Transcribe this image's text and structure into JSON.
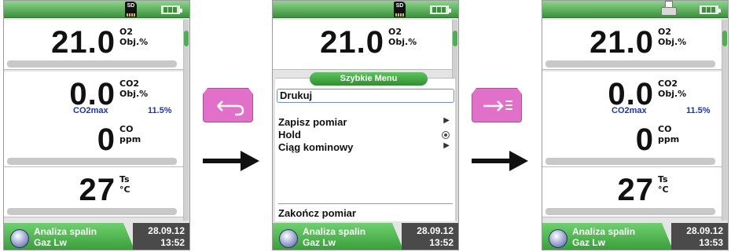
{
  "screen_1": {
    "top": {
      "sd_label": "SD"
    },
    "panels": [
      {
        "value": "21.0",
        "gas": "O2",
        "unit": "Obj.%"
      },
      {
        "value": "0.0",
        "gas": "CO2",
        "unit": "Obj.%",
        "sub_label": "CO2max",
        "sub_value": "11.5%"
      },
      {
        "value": "0",
        "gas": "CO",
        "unit": "ppm"
      },
      {
        "value": "27",
        "gas": "Ts",
        "unit": "°C"
      }
    ],
    "status": {
      "mode": "Analiza spalin",
      "fuel": "Gaz Lw",
      "date": "28.09.12",
      "time": "13:52"
    }
  },
  "screen_2": {
    "top": {
      "sd_label": "SD"
    },
    "panel": {
      "value": "21.0",
      "gas": "O2",
      "unit": "Obj.%"
    },
    "menu": {
      "title": "Szybkie Menu",
      "items": [
        "Drukuj",
        "Zapisz pomiar",
        "Hold",
        "Ciąg kominowy",
        "Zakończ pomiar"
      ]
    },
    "status": {
      "mode": "Analiza spalin",
      "fuel": "Gaz Lw",
      "date": "28.09.12",
      "time": "13:52"
    }
  },
  "screen_3": {
    "panels": [
      {
        "value": "21.0",
        "gas": "O2",
        "unit": "Obj.%"
      },
      {
        "value": "0.0",
        "gas": "CO2",
        "unit": "Obj.%",
        "sub_label": "CO2max",
        "sub_value": "11.5%"
      },
      {
        "value": "0",
        "gas": "CO",
        "unit": "ppm"
      },
      {
        "value": "27",
        "gas": "Ts",
        "unit": "°C"
      }
    ],
    "status": {
      "mode": "Analiza spalin",
      "fuel": "Gaz Lw",
      "date": "28.09.12",
      "time": "13:53"
    }
  },
  "softkeys": {
    "back": "back-arrow-icon",
    "print": "arrow-to-list-icon"
  },
  "colors": {
    "green": "#4caf50",
    "softkey": "#e070c8",
    "sublabel": "#1a35c8"
  }
}
